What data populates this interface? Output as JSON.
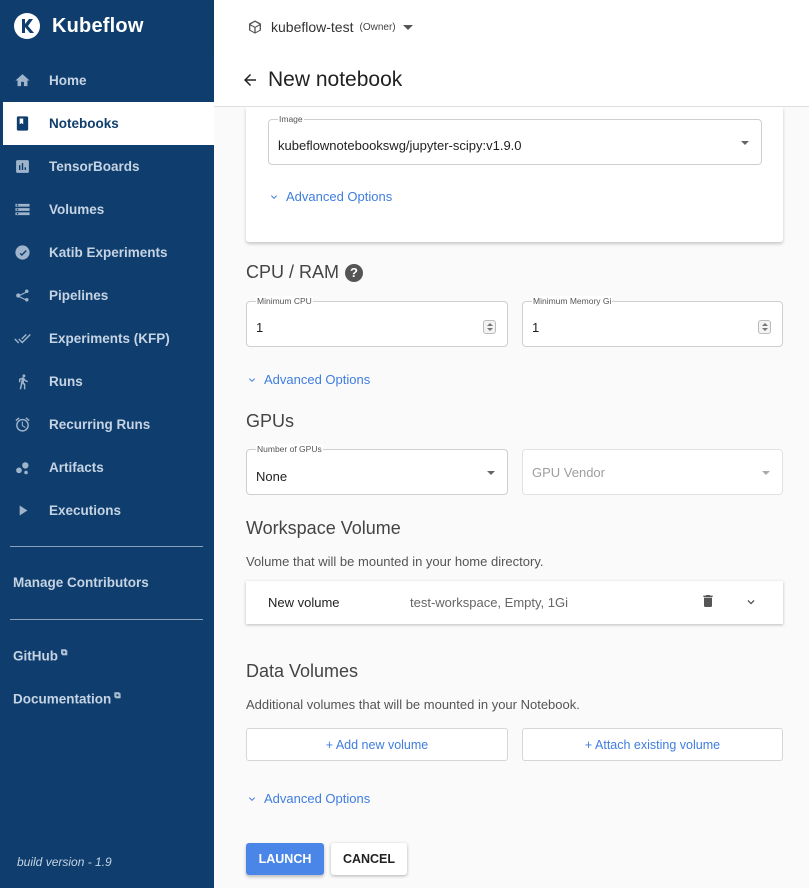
{
  "brand": {
    "name": "Kubeflow",
    "icon": "kubeflow-logo-icon"
  },
  "sidebar": {
    "items": [
      {
        "label": "Home",
        "icon": "home-icon"
      },
      {
        "label": "Notebooks",
        "icon": "notebook-icon",
        "active": true
      },
      {
        "label": "TensorBoards",
        "icon": "chart-icon"
      },
      {
        "label": "Volumes",
        "icon": "storage-icon"
      },
      {
        "label": "Katib Experiments",
        "icon": "dashboard-icon"
      },
      {
        "label": "Pipelines",
        "icon": "pipeline-icon"
      },
      {
        "label": "Experiments (KFP)",
        "icon": "done-all-icon"
      },
      {
        "label": "Runs",
        "icon": "running-icon"
      },
      {
        "label": "Recurring Runs",
        "icon": "alarm-icon"
      },
      {
        "label": "Artifacts",
        "icon": "artifact-icon"
      },
      {
        "label": "Executions",
        "icon": "play-icon"
      }
    ],
    "manage_contributors": "Manage Contributors",
    "github": "GitHub",
    "documentation": "Documentation",
    "build_version": "build version - 1.9"
  },
  "topbar": {
    "namespace": "kubeflow-test",
    "role": "(Owner)"
  },
  "header": {
    "title": "New notebook"
  },
  "image": {
    "label": "Image",
    "value": "kubeflownotebookswg/jupyter-scipy:v1.9.0"
  },
  "advanced_options": "Advanced Options",
  "cpu_ram": {
    "title": "CPU / RAM",
    "help": "?",
    "min_cpu_label": "Minimum CPU",
    "min_cpu_value": "1",
    "min_memory_label": "Minimum Memory Gi",
    "min_memory_value": "1"
  },
  "gpus": {
    "title": "GPUs",
    "num_label": "Number of GPUs",
    "num_value": "None",
    "vendor_placeholder": "GPU Vendor"
  },
  "workspace": {
    "title": "Workspace Volume",
    "description": "Volume that will be mounted in your home directory.",
    "volume_name": "New volume",
    "volume_detail": "test-workspace, Empty, 1Gi"
  },
  "data_volumes": {
    "title": "Data Volumes",
    "description": "Additional volumes that will be mounted in your Notebook.",
    "add_new": "+ Add new volume",
    "attach_existing": "+ Attach existing volume"
  },
  "actions": {
    "launch": "LAUNCH",
    "cancel": "CANCEL"
  },
  "colors": {
    "sidebar": "#0f3e6e",
    "accent": "#4a86e8",
    "link": "#3f7de0"
  }
}
